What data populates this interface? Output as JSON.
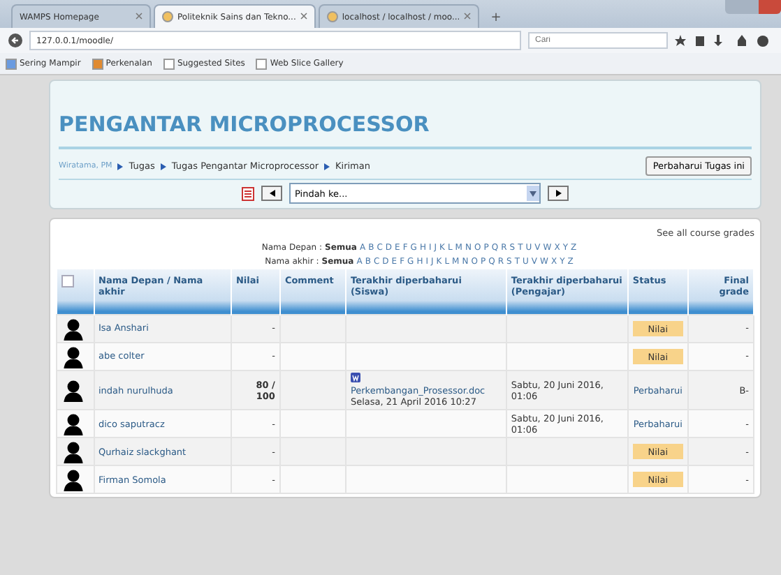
{
  "browser": {
    "tabs": [
      {
        "label": "WAMPS Homepage",
        "selected": false,
        "icon": false
      },
      {
        "label": "Politeknik Sains dan Tekno...",
        "selected": true,
        "icon": true
      },
      {
        "label": "localhost / localhost / moo...",
        "selected": false,
        "icon": true
      }
    ],
    "new_tab": "+",
    "url": "127.0.0.1/moodle/",
    "search": {
      "placeholder": "Cari"
    },
    "bookmarks": [
      "Sering Mampir",
      "Perkenalan",
      "Suggested Sites",
      "Web Slice Gallery"
    ]
  },
  "page": {
    "title": "PENGANTAR MICROPROCESSOR",
    "breadcrumb": [
      "Wiratama, PM",
      "Tugas",
      "Tugas Pengantar Microprocessor",
      "Kiriman"
    ],
    "update_button": "Perbaharui Tugas ini",
    "jump": {
      "value": "Pindah ke..."
    },
    "see_all": "See all course grades",
    "first_name_filter": {
      "label": "Nama Depan :",
      "all": "Semua",
      "letters": [
        "A",
        "B",
        "C",
        "D",
        "E",
        "F",
        "G",
        "H",
        "I",
        "J",
        "K",
        "L",
        "M",
        "N",
        "O",
        "P",
        "Q",
        "R",
        "S",
        "T",
        "U",
        "V",
        "W",
        "X",
        "Y",
        "Z"
      ]
    },
    "last_name_filter": {
      "label": "Nama akhir :",
      "all": "Semua",
      "letters": [
        "A",
        "B",
        "C",
        "D",
        "E",
        "F",
        "G",
        "H",
        "I",
        "J",
        "K",
        "L",
        "M",
        "N",
        "O",
        "P",
        "Q",
        "R",
        "S",
        "T",
        "U",
        "V",
        "W",
        "X",
        "Y",
        "Z"
      ]
    }
  },
  "table": {
    "select_all": {
      "checked": false
    },
    "columns": [
      "Nama Depan / Nama akhir",
      "Nilai",
      "Comment",
      "Terakhir diperbaharui (Siswa)",
      "Terakhir diperbaharui (Pengajar)",
      "Status",
      "Final grade"
    ],
    "rows": [
      {
        "name": "Isa Anshari",
        "grade": "-",
        "file": null,
        "student_date": null,
        "teacher_date": null,
        "status": {
          "kind": "button",
          "label": "Nilai"
        },
        "final": "-"
      },
      {
        "name": "abe colter",
        "grade": "-",
        "file": null,
        "student_date": null,
        "teacher_date": null,
        "status": {
          "kind": "button",
          "label": "Nilai"
        },
        "final": "-"
      },
      {
        "name": "indah nurulhuda",
        "grade": "80 / 100",
        "file": "Perkembangan_Prosessor.doc",
        "student_date": "Selasa, 21 April 2016 10:27",
        "teacher_date": "Sabtu, 20 Juni 2016, 01:06",
        "status": {
          "kind": "link",
          "label": "Perbaharui"
        },
        "final": "B-"
      },
      {
        "name": "dico saputracz",
        "grade": "-",
        "file": null,
        "student_date": null,
        "teacher_date": "Sabtu, 20 Juni 2016, 01:06",
        "status": {
          "kind": "link",
          "label": "Perbaharui"
        },
        "final": "-"
      },
      {
        "name": "Qurhaiz slackghant",
        "grade": "-",
        "file": null,
        "student_date": null,
        "teacher_date": null,
        "status": {
          "kind": "button",
          "label": "Nilai"
        },
        "final": "-"
      },
      {
        "name": "Firman Somola",
        "grade": "-",
        "file": null,
        "student_date": null,
        "teacher_date": null,
        "status": {
          "kind": "button",
          "label": "Nilai"
        },
        "final": "-"
      }
    ]
  }
}
